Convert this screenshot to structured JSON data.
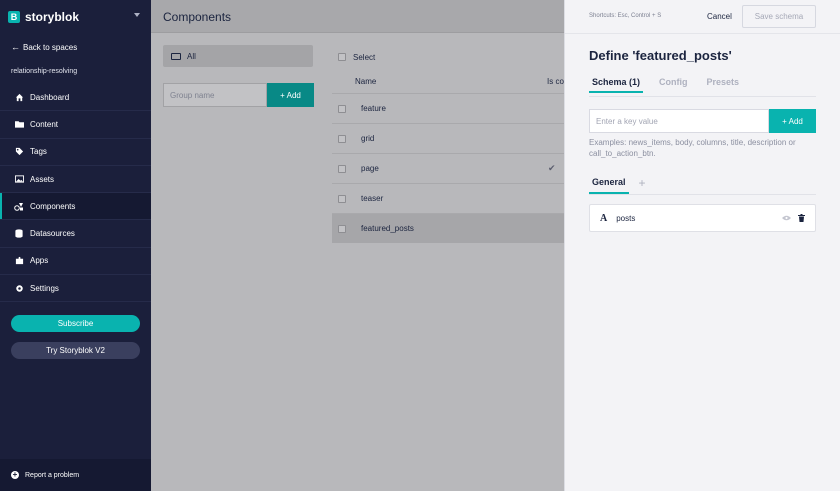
{
  "sidebar": {
    "brand": "storyblok",
    "brand_logo_letter": "B",
    "back_link": "Back to spaces",
    "space_name": "relationship-resolving",
    "items": [
      {
        "label": "Dashboard",
        "icon": "home-icon"
      },
      {
        "label": "Content",
        "icon": "folder-icon"
      },
      {
        "label": "Tags",
        "icon": "tag-icon"
      },
      {
        "label": "Assets",
        "icon": "image-icon"
      },
      {
        "label": "Components",
        "icon": "components-icon",
        "active": true
      },
      {
        "label": "Datasources",
        "icon": "database-icon"
      },
      {
        "label": "Apps",
        "icon": "puzzle-icon"
      },
      {
        "label": "Settings",
        "icon": "gear-icon"
      }
    ],
    "subscribe_label": "Subscribe",
    "try_label": "Try Storyblok V2",
    "report_label": "Report a problem"
  },
  "main": {
    "title": "Components",
    "group_all": "All",
    "group_placeholder": "Group name",
    "group_add_label": "+ Add",
    "select_label": "Select",
    "col_name": "Name",
    "col_is": "Is co",
    "rows": [
      {
        "name": "feature",
        "checked": false
      },
      {
        "name": "grid",
        "checked": false
      },
      {
        "name": "page",
        "checked": true
      },
      {
        "name": "teaser",
        "checked": false
      },
      {
        "name": "featured_posts",
        "checked": false,
        "highlight": true
      }
    ]
  },
  "panel": {
    "shortcuts": "Shortcuts: Esc, Control + S",
    "cancel_label": "Cancel",
    "save_label": "Save schema",
    "title": "Define 'featured_posts'",
    "tabs": [
      "Schema (1)",
      "Config",
      "Presets"
    ],
    "key_placeholder": "Enter a key value",
    "key_add_label": "+ Add",
    "examples": "Examples: news_items, body, columns, title, description or call_to_action_btn.",
    "sub_tab": "General",
    "sub_tab_add": "+",
    "field": {
      "type_glyph": "A",
      "name": "posts"
    }
  },
  "colors": {
    "accent": "#09b3af",
    "sidebar": "#1b1f3b",
    "text": "#1b243f"
  }
}
